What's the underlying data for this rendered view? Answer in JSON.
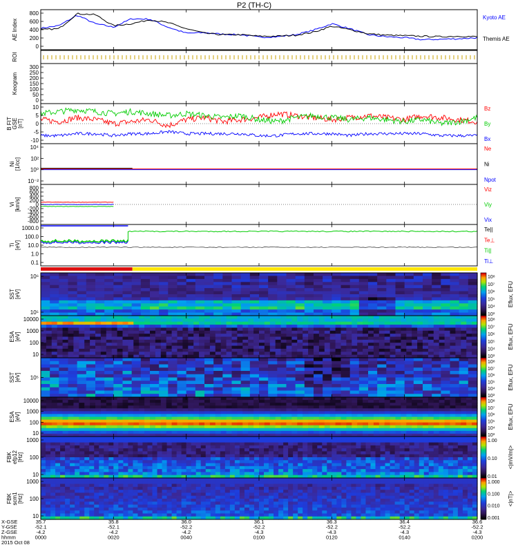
{
  "title": "P2 (TH-C)",
  "chart_data": [
    {
      "id": "ae",
      "type": "line",
      "ylabel": "AE Index",
      "yticks": [
        "800",
        "600",
        "400",
        "200",
        "0"
      ],
      "ylim": [
        0,
        800
      ],
      "x": [
        "00:00",
        "00:05",
        "00:10",
        "00:15",
        "00:20",
        "00:25",
        "00:30",
        "00:35",
        "00:40",
        "00:45",
        "00:50",
        "00:55",
        "01:00",
        "01:05",
        "01:10",
        "01:15",
        "01:20",
        "01:25",
        "01:30",
        "01:35",
        "01:40",
        "01:45",
        "01:50",
        "01:55",
        "02:00"
      ],
      "series": [
        {
          "name": "Kyoto AE",
          "color": "#0000ff",
          "values": [
            430,
            480,
            690,
            520,
            450,
            620,
            610,
            450,
            330,
            340,
            310,
            300,
            250,
            260,
            300,
            390,
            520,
            420,
            300,
            260,
            240,
            200,
            210,
            220,
            240
          ]
        },
        {
          "name": "Themis AE",
          "color": "#000000",
          "values": [
            400,
            420,
            720,
            700,
            480,
            520,
            600,
            540,
            420,
            330,
            300,
            300,
            270,
            270,
            290,
            350,
            470,
            400,
            320,
            290,
            280,
            270,
            260,
            270,
            260
          ]
        }
      ]
    },
    {
      "id": "roi",
      "type": "line",
      "ylabel": "ROI"
    },
    {
      "id": "keogram",
      "type": "line",
      "ylabel": "Keogram",
      "yticks": [
        "300",
        "250",
        "200",
        "150",
        "100",
        "50",
        "0"
      ],
      "ylim": [
        0,
        300
      ]
    },
    {
      "id": "bfield",
      "type": "line",
      "ylabel": "B FIT",
      "ylabel2": "GSE",
      "yunits": "[nT]",
      "yticks": [
        "10",
        "5",
        "0",
        "-5",
        "-10"
      ],
      "ylim": [
        -10,
        10
      ],
      "series": [
        {
          "name": "Bz",
          "color": "#ff0000",
          "values": [
            2,
            1,
            3,
            2,
            0,
            1,
            2,
            -1,
            2,
            3,
            1,
            2,
            3,
            5,
            4,
            3,
            2,
            3,
            4,
            3,
            2,
            4,
            3,
            2,
            1
          ]
        },
        {
          "name": "By",
          "color": "#00cc00",
          "values": [
            5,
            6,
            7,
            6,
            5,
            6,
            5,
            4,
            5,
            4,
            3,
            4,
            2,
            1,
            3,
            4,
            3,
            2,
            3,
            2,
            1,
            2,
            0,
            1,
            3
          ]
        },
        {
          "name": "Bx",
          "color": "#0000ff",
          "values": [
            -6,
            -6,
            -5,
            -5,
            -6,
            -5,
            -5,
            -4,
            -5,
            -5,
            -5,
            -5,
            -6,
            -6,
            -5,
            -5,
            -5,
            -6,
            -5,
            -5,
            -5,
            -5,
            -6,
            -6,
            -6
          ]
        }
      ]
    },
    {
      "id": "density",
      "type": "line",
      "ylabel": "Ni",
      "yunits": "[1/cc]",
      "yticks": [
        "10⁴",
        "10²",
        "10⁰",
        "10⁻²"
      ],
      "series": [
        {
          "name": "Ne",
          "color": "#ff0000"
        },
        {
          "name": "Ni",
          "color": "#000000"
        },
        {
          "name": "Npot",
          "color": "#0000ff"
        }
      ]
    },
    {
      "id": "velocity",
      "type": "line",
      "ylabel": "Vi",
      "yunits": "[km/s]",
      "yticks": [
        "800",
        "600",
        "400",
        "200",
        "0",
        "-200",
        "-400",
        "-600",
        "-800"
      ],
      "ylim": [
        -800,
        800
      ],
      "x_end": "00:20",
      "series": [
        {
          "name": "Viz",
          "color": "#ff0000",
          "value": 90
        },
        {
          "name": "Viy",
          "color": "#00cc00",
          "value": -80
        },
        {
          "name": "Vix",
          "color": "#0000ff",
          "value": 0
        }
      ]
    },
    {
      "id": "temperature",
      "type": "line",
      "ylabel": "Ti",
      "yunits": "[eV]",
      "yticks": [
        "1000.0",
        "100.0",
        "10.0",
        "1.0",
        "0.1"
      ],
      "series": [
        {
          "name": "Te||",
          "color": "#000000"
        },
        {
          "name": "Te⊥",
          "color": "#ff0000"
        },
        {
          "name": "Ti||",
          "color": "#00cc00"
        },
        {
          "name": "Ti⊥",
          "color": "#0000ff"
        }
      ]
    },
    {
      "id": "sst_ion",
      "type": "heatmap",
      "ylabel": "SST",
      "yunits": "[eV]",
      "yticks": [
        "10⁶",
        "10⁵"
      ],
      "cbar_ticks": [
        "10⁸",
        "10⁷",
        "10⁶",
        "10⁵",
        "10⁴",
        "10³"
      ],
      "cbar_label": "Eflux, EFU"
    },
    {
      "id": "esa_ion",
      "type": "heatmap",
      "ylabel": "ESA",
      "yunits": "[eV]",
      "yticks": [
        "10000",
        "1000",
        "100",
        "10"
      ],
      "cbar_ticks": [
        "10⁸",
        "10⁷",
        "10⁶",
        "10⁵",
        "10⁴",
        "10³"
      ],
      "cbar_label": "Eflux, EFU"
    },
    {
      "id": "sst_elec",
      "type": "heatmap",
      "ylabel": "SST",
      "yunits": "[eV]",
      "yticks": [
        "10⁵"
      ],
      "cbar_ticks": [
        "10⁸",
        "10⁷",
        "10⁶",
        "10⁵",
        "10⁴",
        "10³"
      ],
      "cbar_label": "Eflux, EFU"
    },
    {
      "id": "esa_elec",
      "type": "heatmap",
      "ylabel": "ESA",
      "yunits": "[eV]",
      "yticks": [
        "10000",
        "1000",
        "100",
        "10"
      ],
      "cbar_ticks": [
        "10⁸",
        "10⁷",
        "10⁶",
        "10⁵",
        "10⁴",
        "10³"
      ],
      "cbar_label": "Eflux, EFU"
    },
    {
      "id": "fbk_e",
      "type": "heatmap",
      "ylabel": "FBK",
      "ylabel2": "efp12",
      "yunits": "[Hz]",
      "yticks": [
        "1000",
        "100",
        "10"
      ],
      "cbar_ticks": [
        "1.00",
        "0.10",
        "0.01"
      ],
      "cbar_label": "<|mV/m|>"
    },
    {
      "id": "fbk_b",
      "type": "heatmap",
      "ylabel": "FBK",
      "ylabel2": "scm1",
      "yunits": "[Hz]",
      "yticks": [
        "1000",
        "100",
        "10"
      ],
      "cbar_ticks": [
        "1.000",
        "0.100",
        "0.010",
        "0.001"
      ],
      "cbar_label": "<|nT|>"
    }
  ],
  "orbit": {
    "row_labels": [
      "X-GSE",
      "Y-GSE",
      "Z-GSE",
      "hhmm",
      "2015 Oct 08"
    ],
    "columns": [
      {
        "values": [
          "35.7",
          "-52.1",
          "-4.2",
          "0000"
        ]
      },
      {
        "values": [
          "35.8",
          "-52.1",
          "-4.2",
          "0020"
        ]
      },
      {
        "values": [
          "36.0",
          "-52.2",
          "-4.2",
          "0040"
        ]
      },
      {
        "values": [
          "36.1",
          "-52.2",
          "-4.3",
          "0100"
        ]
      },
      {
        "values": [
          "36.3",
          "-52.2",
          "-4.3",
          "0120"
        ]
      },
      {
        "values": [
          "36.4",
          "-52.2",
          "-4.3",
          "0140"
        ]
      },
      {
        "values": [
          "36.6",
          "-52.2",
          "-4.3",
          "0200"
        ]
      }
    ]
  }
}
